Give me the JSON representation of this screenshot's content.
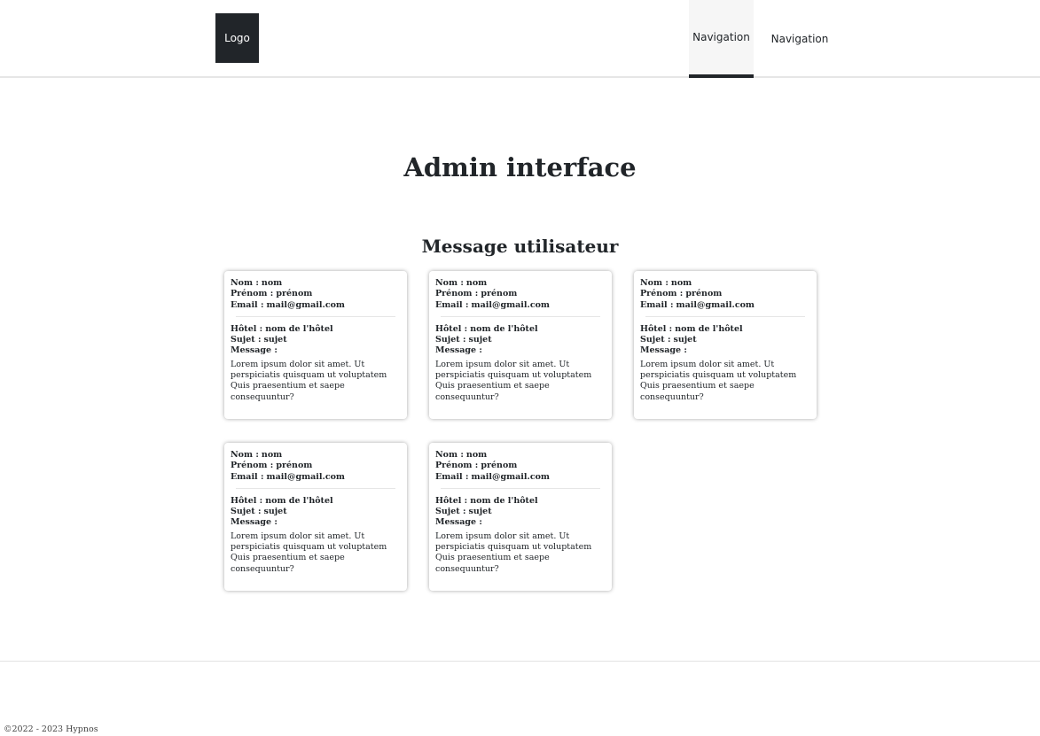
{
  "header": {
    "logo": "Logo",
    "nav": [
      "Navigation",
      "Navigation"
    ]
  },
  "main": {
    "title": "Admin interface",
    "subtitle": "Message utilisateur",
    "labels": {
      "nom": "Nom :",
      "prenom": "Prénom :",
      "email": "Email :",
      "hotel": "Hôtel :",
      "sujet": "Sujet :",
      "message": "Message :"
    },
    "cards": [
      {
        "nom": "nom",
        "prenom": "prénom",
        "email": "mail@gmail.com",
        "hotel": "nom de l'hôtel",
        "sujet": "sujet",
        "message": "Lorem ipsum dolor sit amet. Ut perspiciatis quisquam ut voluptatem Quis praesentium et saepe consequuntur?"
      },
      {
        "nom": "nom",
        "prenom": "prénom",
        "email": "mail@gmail.com",
        "hotel": "nom de l'hôtel",
        "sujet": "sujet",
        "message": "Lorem ipsum dolor sit amet. Ut perspiciatis quisquam ut voluptatem Quis praesentium et saepe consequuntur?"
      },
      {
        "nom": "nom",
        "prenom": "prénom",
        "email": "mail@gmail.com",
        "hotel": "nom de l'hôtel",
        "sujet": "sujet",
        "message": "Lorem ipsum dolor sit amet. Ut perspiciatis quisquam ut voluptatem Quis praesentium et saepe consequuntur?"
      },
      {
        "nom": "nom",
        "prenom": "prénom",
        "email": "mail@gmail.com",
        "hotel": "nom de l'hôtel",
        "sujet": "sujet",
        "message": "Lorem ipsum dolor sit amet. Ut perspiciatis quisquam ut voluptatem Quis praesentium et saepe consequuntur?"
      },
      {
        "nom": "nom",
        "prenom": "prénom",
        "email": "mail@gmail.com",
        "hotel": "nom de l'hôtel",
        "sujet": "sujet",
        "message": "Lorem ipsum dolor sit amet. Ut perspiciatis quisquam ut voluptatem Quis praesentium et saepe consequuntur?"
      }
    ]
  },
  "footer": {
    "copyright": "©2022 - 2023 Hypnos"
  }
}
